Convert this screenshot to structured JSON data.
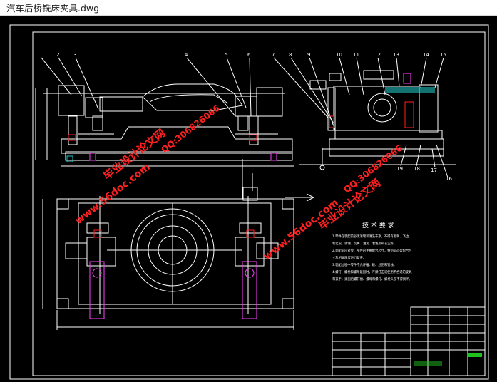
{
  "window": {
    "title": "汽车后桥铣床夹具.dwg"
  },
  "drawing": {
    "background": "#000000",
    "line_color": "#ffffff",
    "accent_color": "#ff2020",
    "highlight_cyan": "#20c0c0",
    "highlight_magenta": "#ff40ff",
    "balloon_numbers": [
      "1",
      "2",
      "3",
      "4",
      "5",
      "6",
      "7",
      "8",
      "9",
      "10",
      "11",
      "12",
      "13",
      "14",
      "15",
      "16",
      "17",
      "18",
      "19"
    ],
    "tech_title": "技 术 要 求",
    "tech_lines": [
      "1.零件在装配前必须清理和清洗干净，不得有毛刺、飞边、",
      "氧化皮、锈蚀、切屑、油污、着色剂和灰尘等。",
      "2.装配前应对零、部件的主要配合尺寸，特别是过盈配合尺",
      "寸及相关精度进行复查。",
      "3.装配过程中零件不允许磕、碰、划伤和锈蚀。",
      "4.螺钉、螺栓和螺母紧固时，严禁打击或使用不合适的旋具",
      "和扳手。紧固后螺钉槽、螺母和螺钉、螺栓头部不得损坏。"
    ]
  },
  "watermarks": [
    {
      "text": "毕业设计论文网",
      "color": "#ff2020"
    },
    {
      "text": "www.56doc.com",
      "color": "#ff2020"
    },
    {
      "text": "QQ:306826066",
      "color": "#ff2020"
    },
    {
      "text": "毕业设计论文网",
      "color": "#ff2020"
    },
    {
      "text": "www.56doc.com",
      "color": "#ff2020"
    },
    {
      "text": "QQ:306826066",
      "color": "#ff2020"
    }
  ]
}
